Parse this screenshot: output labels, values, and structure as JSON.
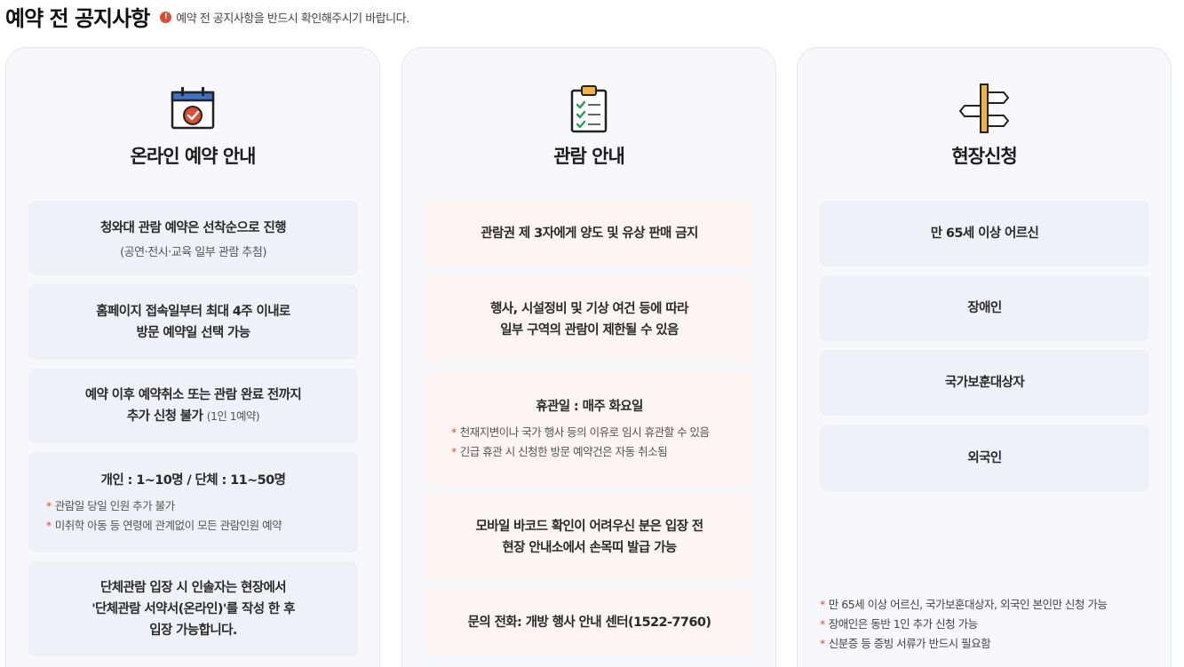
{
  "header": {
    "title": "예약 전 공지사항",
    "notice_icon": "!",
    "notice": "예약 전 공지사항을 반드시 확인해주시기 바랍니다."
  },
  "colors": {
    "accent": "#e04a2f",
    "card_gray": "#eef1f7",
    "card_peach": "#fcf5f1"
  },
  "online": {
    "icon": "calendar-check-icon",
    "title": "온라인 예약 안내",
    "cards": [
      {
        "text": "청와대 관람 예약은 선착순으로 진행",
        "sub": "(공연·전시·교육 일부 관람 추첨)"
      },
      {
        "line1": "홈페이지 접속일부터 최대 4주 이내로",
        "line2": "방문 예약일 선택 가능"
      },
      {
        "line1": "예약 이후 예약취소 또는 관람 완료 전까지",
        "line2": "추가 신청 불가",
        "note": "(1인 1예약)"
      },
      {
        "text": "개인 : 1~10명 / 단체 : 11~50명",
        "notes": [
          "관람일 당일 인원 추가 불가",
          "미취학 아동 등 연령에 관계없이 모든 관람인원 예약"
        ]
      },
      {
        "line1": "단체관람 입장 시 인솔자는 현장에서",
        "line2": "'단체관람 서약서(온라인)'를 작성 한 후",
        "line3": "입장 가능합니다."
      }
    ]
  },
  "viewing": {
    "icon": "clipboard-checklist-icon",
    "title": "관람 안내",
    "cards": [
      {
        "text": "관람권 제 3자에게 양도 및 유상 판매 금지"
      },
      {
        "line1": "행사, 시설정비 및 기상 여건 등에 따라",
        "line2": "일부 구역의 관람이 제한될 수 있음"
      },
      {
        "text": "휴관일 : 매주 화요일",
        "notes": [
          "천재지변이나 국가 행사 등의 이유로 임시 휴관할 수 있음",
          "긴급 휴관 시 신청한 방문 예약건은 자동 취소됨"
        ]
      },
      {
        "line1": "모바일 바코드 확인이 어려우신 분은 입장 전",
        "line2": "현장 안내소에서 손목띠 발급 가능"
      },
      {
        "text": "문의 전화: 개방 행사 안내 센터(1522-7760)"
      }
    ]
  },
  "onsite": {
    "icon": "signpost-icon",
    "title": "현장신청",
    "cards": [
      "만 65세 이상 어르신",
      "장애인",
      "국가보훈대상자",
      "외국인"
    ],
    "footnotes": [
      "만 65세 이상 어르신, 국가보훈대상자, 외국인 본인만 신청 가능",
      "장애인은 동반 1인 추가 신청 가능",
      "신분증 등 증빙 서류가 반드시 필요함"
    ]
  }
}
